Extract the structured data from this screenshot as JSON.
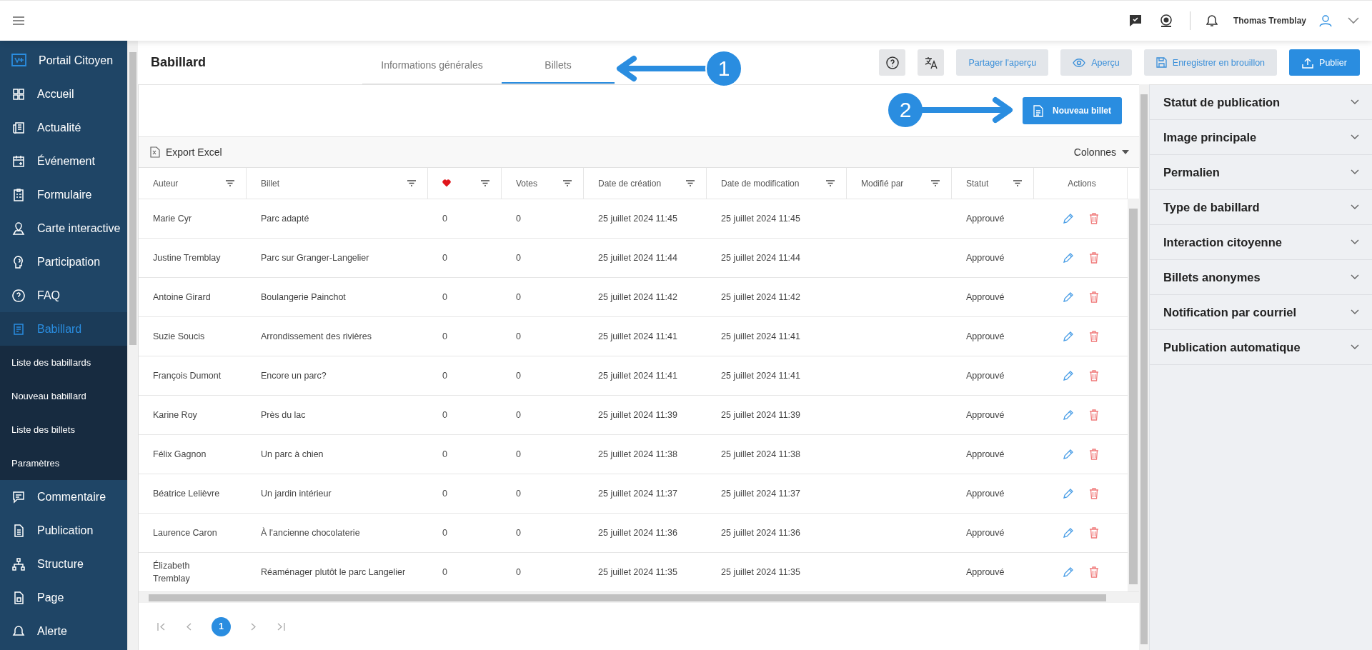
{
  "topbar": {
    "user_name": "Thomas Tremblay"
  },
  "sidebar": {
    "header": "Portail Citoyen",
    "items": [
      {
        "label": "Accueil",
        "selected": false
      },
      {
        "label": "Actualité",
        "selected": false
      },
      {
        "label": "Événement",
        "selected": false
      },
      {
        "label": "Formulaire",
        "selected": false
      },
      {
        "label": "Carte interactive",
        "selected": false
      },
      {
        "label": "Participation",
        "selected": false
      },
      {
        "label": "FAQ",
        "selected": false
      },
      {
        "label": "Babillard",
        "selected": true,
        "children": [
          {
            "label": "Liste des babillards",
            "selected": false
          },
          {
            "label": "Nouveau babillard",
            "selected": false
          },
          {
            "label": "Liste des billets",
            "selected": false
          },
          {
            "label": "Paramètres",
            "selected": false
          }
        ]
      },
      {
        "label": "Commentaire",
        "selected": false
      },
      {
        "label": "Publication",
        "selected": false
      },
      {
        "label": "Structure",
        "selected": false
      },
      {
        "label": "Page",
        "selected": false
      },
      {
        "label": "Alerte",
        "selected": false
      }
    ]
  },
  "page": {
    "title": "Babillard",
    "tabs": [
      {
        "label": "Informations générales",
        "selected": false
      },
      {
        "label": "Billets",
        "selected": true
      }
    ],
    "buttons": [
      {
        "label": "Partager l'aperçu",
        "kind": "share"
      },
      {
        "label": "Aperçu",
        "kind": "preview"
      },
      {
        "label": "Enregistrer en brouillon",
        "kind": "draft"
      },
      {
        "label": "Publier",
        "kind": "publish"
      }
    ]
  },
  "annotations": [
    {
      "label": "1"
    },
    {
      "label": "2"
    }
  ],
  "new_button": "Nouveau billet",
  "toolbar": {
    "export": "Export Excel",
    "columns": "Colonnes"
  },
  "table": {
    "columns": [
      {
        "label": "Auteur",
        "kind": "text",
        "filterable": true
      },
      {
        "label": "Billet",
        "kind": "text",
        "filterable": true
      },
      {
        "kind": "heart",
        "filterable": true
      },
      {
        "label": "Votes",
        "kind": "text",
        "filterable": true
      },
      {
        "label": "Date de création",
        "kind": "text",
        "filterable": true
      },
      {
        "label": "Date de modification",
        "kind": "text",
        "filterable": true
      },
      {
        "label": "Modifié par",
        "kind": "text",
        "filterable": true
      },
      {
        "label": "Statut",
        "kind": "text",
        "filterable": true
      },
      {
        "label": "Actions",
        "kind": "actions",
        "filterable": false
      }
    ],
    "rows": [
      {
        "author": "Marie Cyr",
        "ticket": "Parc adapté",
        "likes": "0",
        "votes": "0",
        "created": "25 juillet 2024 11:45",
        "modified": "25 juillet 2024 11:45",
        "status": "Approuvé"
      },
      {
        "author": "Justine Tremblay",
        "ticket": "Parc sur Granger-Langelier",
        "likes": "0",
        "votes": "0",
        "created": "25 juillet 2024 11:44",
        "modified": "25 juillet 2024 11:44",
        "status": "Approuvé"
      },
      {
        "author": "Antoine Girard",
        "ticket": "Boulangerie Painchot",
        "likes": "0",
        "votes": "0",
        "created": "25 juillet 2024 11:42",
        "modified": "25 juillet 2024 11:42",
        "status": "Approuvé"
      },
      {
        "author": "Suzie Soucis",
        "ticket": "Arrondissement des rivières",
        "likes": "0",
        "votes": "0",
        "created": "25 juillet 2024 11:41",
        "modified": "25 juillet 2024 11:41",
        "status": "Approuvé"
      },
      {
        "author": "François Dumont",
        "ticket": "Encore un parc?",
        "likes": "0",
        "votes": "0",
        "created": "25 juillet 2024 11:41",
        "modified": "25 juillet 2024 11:41",
        "status": "Approuvé"
      },
      {
        "author": "Karine Roy",
        "ticket": "Près du lac",
        "likes": "0",
        "votes": "0",
        "created": "25 juillet 2024 11:39",
        "modified": "25 juillet 2024 11:39",
        "status": "Approuvé"
      },
      {
        "author": "Félix Gagnon",
        "ticket": "Un parc à chien",
        "likes": "0",
        "votes": "0",
        "created": "25 juillet 2024 11:38",
        "modified": "25 juillet 2024 11:38",
        "status": "Approuvé"
      },
      {
        "author": "Béatrice Lelièvre",
        "ticket": "Un jardin intérieur",
        "likes": "0",
        "votes": "0",
        "created": "25 juillet 2024 11:37",
        "modified": "25 juillet 2024 11:37",
        "status": "Approuvé"
      },
      {
        "author": "Laurence Caron",
        "ticket": "À l'ancienne chocolaterie",
        "likes": "0",
        "votes": "0",
        "created": "25 juillet 2024 11:36",
        "modified": "25 juillet 2024 11:36",
        "status": "Approuvé"
      },
      {
        "author": "Élizabeth Tremblay",
        "ticket": "Réaménager plutôt le parc Langelier",
        "likes": "0",
        "votes": "0",
        "created": "25 juillet 2024 11:35",
        "modified": "25 juillet 2024 11:35",
        "status": "Approuvé"
      }
    ]
  },
  "pagination": {
    "pages": [
      {
        "label": "1",
        "selected": true
      }
    ]
  },
  "settings": {
    "sections": [
      {
        "label": "Statut de publication",
        "expanded": false
      },
      {
        "label": "Image principale",
        "expanded": false
      },
      {
        "label": "Permalien",
        "expanded": false
      },
      {
        "label": "Type de babillard",
        "expanded": false
      },
      {
        "label": "Interaction citoyenne",
        "expanded": false
      },
      {
        "label": "Billets anonymes",
        "expanded": false
      },
      {
        "label": "Notification par courriel",
        "expanded": false
      },
      {
        "label": "Publication automatique",
        "expanded": false
      }
    ]
  }
}
